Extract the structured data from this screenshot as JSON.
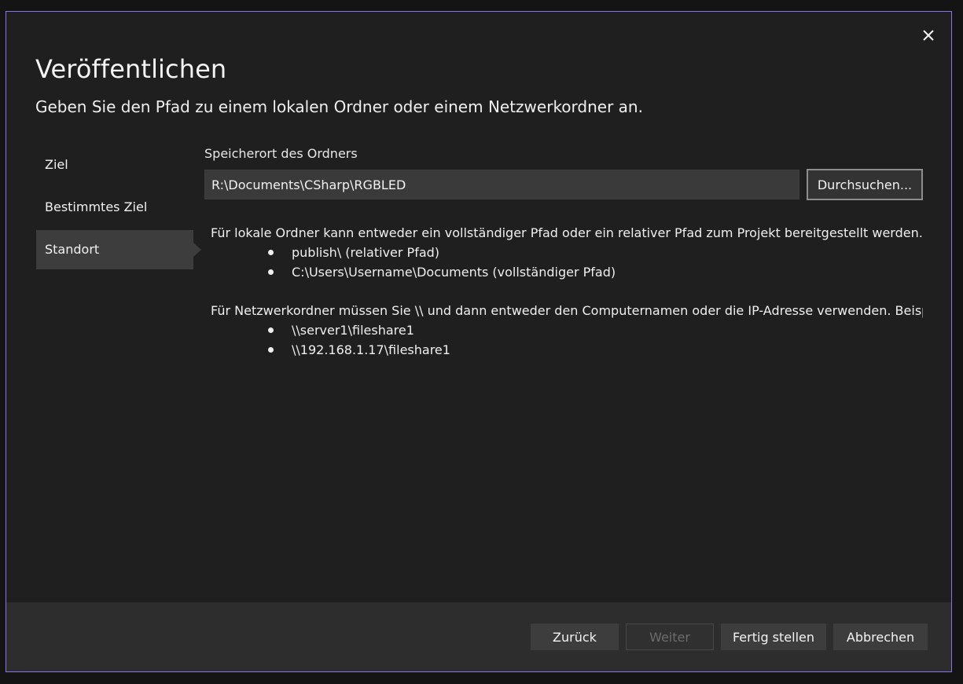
{
  "dialog": {
    "title": "Veröffentlichen",
    "subtitle": "Geben Sie den Pfad zu einem lokalen Ordner oder einem Netzwerkordner an.",
    "close_glyph": "×",
    "accent_color": "#8b72e8"
  },
  "nav": {
    "items": [
      {
        "label": "Ziel",
        "active": false
      },
      {
        "label": "Bestimmtes Ziel",
        "active": false
      },
      {
        "label": "Standort",
        "active": true
      }
    ]
  },
  "content": {
    "field_label": "Speicherort des Ordners",
    "path_value": "R:\\Documents\\CSharp\\RGBLED",
    "browse_label": "Durchsuchen...",
    "help": {
      "local_text": "Für lokale Ordner kann entweder ein vollständiger Pfad oder ein relativer Pfad zum Projekt bereitgestellt werden. B",
      "local_examples": [
        "publish\\ (relativer Pfad)",
        "C:\\Users\\Username\\Documents (vollständiger Pfad)"
      ],
      "network_text": "Für Netzwerkordner müssen Sie \\\\ und dann entweder den Computernamen oder die IP-Adresse verwenden. Beisp",
      "network_examples": [
        "\\\\server1\\fileshare1",
        "\\\\192.168.1.17\\fileshare1"
      ]
    }
  },
  "footer": {
    "back_label": "Zurück",
    "next_label": "Weiter",
    "finish_label": "Fertig stellen",
    "cancel_label": "Abbrechen"
  }
}
